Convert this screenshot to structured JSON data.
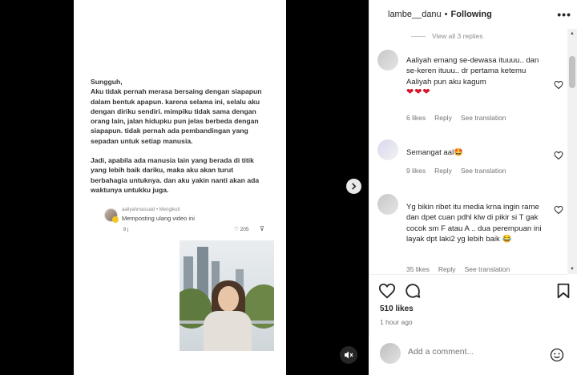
{
  "post": {
    "text_paragraphs": [
      "Sungguh,\nAku tidak pernah merasa bersaing dengan siapapun dalam bentuk apapun. karena selama ini, selalu aku dengan diriku sendiri. mimpiku tidak sama dengan orang lain, jalan hidupku pun jelas berbeda dengan siapapun. tidak pernah ada pembandingan yang sepadan untuk setiap manusia.",
      "Jadi, apabila ada manusia lain yang berada di titik yang lebih baik dariku, maka aku akan turut berbahagia untuknya. dan aku yakin nanti akan ada waktunya untukku juga."
    ],
    "repost": {
      "username": "aaliyahmassaid • Mengikuti",
      "label": "Memposting ulang video ini",
      "sub": "8 j",
      "likes": "205"
    }
  },
  "header": {
    "username": "lambe__danu",
    "separator": "•",
    "follow_status": "Following",
    "more": "•••"
  },
  "comments": {
    "view_replies": "View all 3 replies",
    "items": [
      {
        "text": "Aaliyah emang se-dewasa ituuuu.. dan se-keren ituuu.. dr pertama ketemu Aaliyah pun aku kagum",
        "hearts": "❤❤❤",
        "likes": "6 likes",
        "reply": "Reply",
        "translate": "See translation"
      },
      {
        "text": "Semangat aal🤩",
        "likes": "9 likes",
        "reply": "Reply",
        "translate": "See translation"
      },
      {
        "text": "Yg bikin ribet itu media krna ingin rame dan dpet cuan pdhl klw di pikir si T gak cocok sm F atau A .. dua perempuan ini layak dpt laki2 yg lebih baik 😂",
        "likes": "35 likes",
        "reply": "Reply",
        "translate": "See translation"
      }
    ]
  },
  "stats": {
    "likes": "510 likes",
    "time": "1 hour ago"
  },
  "add_comment": {
    "placeholder": "Add a comment..."
  },
  "icons": [
    "chevron-right-icon",
    "mute-icon",
    "heart-icon",
    "comment-icon",
    "bookmark-icon",
    "emoji-icon",
    "more-icon"
  ]
}
